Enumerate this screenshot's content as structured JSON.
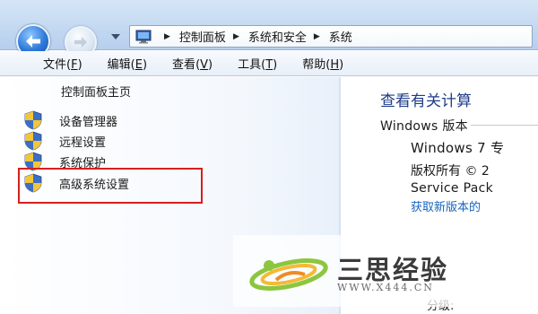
{
  "address_bar": {
    "breadcrumbs": [
      "控制面板",
      "系统和安全",
      "系统"
    ]
  },
  "menu": {
    "items": [
      {
        "label": "文件",
        "key": "F"
      },
      {
        "label": "编辑",
        "key": "E"
      },
      {
        "label": "查看",
        "key": "V"
      },
      {
        "label": "工具",
        "key": "T"
      },
      {
        "label": "帮助",
        "key": "H"
      }
    ]
  },
  "left_pane": {
    "home_label": "控制面板主页",
    "tasks": [
      {
        "label": "设备管理器",
        "icon": "uac-shield-icon"
      },
      {
        "label": "远程设置",
        "icon": "uac-shield-icon"
      },
      {
        "label": "系统保护",
        "icon": "uac-shield-icon"
      },
      {
        "label": "高级系统设置",
        "icon": "uac-shield-icon"
      }
    ],
    "highlighted_task": "高级系统设置"
  },
  "content": {
    "title": "查看有关计算",
    "section_label": "Windows 版本",
    "edition": "Windows 7 专",
    "copyright": "版权所有 © 2",
    "service_pack": "Service Pack",
    "get_new_version_link": "获取新版本的",
    "rating_label": "分级:"
  },
  "watermark": {
    "brand": "三思经验",
    "url": "WWW.X444.CN"
  },
  "colors": {
    "accent_title": "#1e3c8a",
    "link": "#1565c0",
    "highlight_border": "#d61f1f",
    "titlebar": "#c4d9f1"
  }
}
